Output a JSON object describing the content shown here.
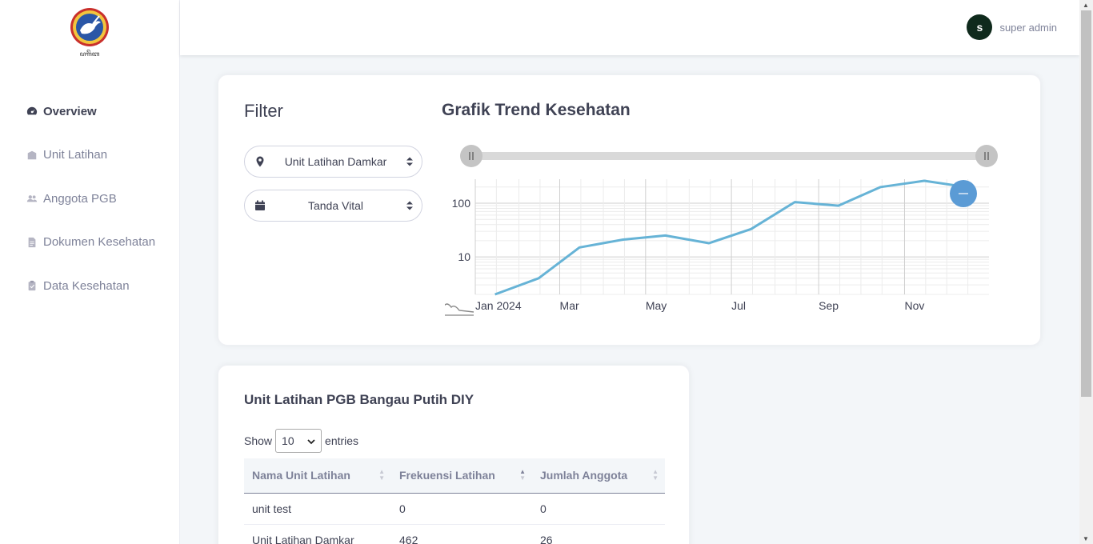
{
  "app": {
    "logo_text": "ꦥꦒꦼꦧꦱꦁꦒꦺꦪꦸꦛꦶꦃ",
    "colors": {
      "accent": "#5b9bd5",
      "line": "#66b3d6",
      "avatar": "#0f2a1c"
    }
  },
  "sidebar": {
    "items": [
      {
        "label": "Overview",
        "icon": "dashboard-icon",
        "active": true
      },
      {
        "label": "Unit Latihan",
        "icon": "building-icon",
        "active": false
      },
      {
        "label": "Anggota PGB",
        "icon": "users-icon",
        "active": false
      },
      {
        "label": "Dokumen Kesehatan",
        "icon": "file-icon",
        "active": false
      },
      {
        "label": "Data Kesehatan",
        "icon": "clipboard-icon",
        "active": false
      }
    ]
  },
  "topbar": {
    "avatar_letter": "s",
    "username": "super admin"
  },
  "filter": {
    "title": "Filter",
    "unit_select": {
      "value": "Unit Latihan Damkar",
      "icon": "map-marker-icon"
    },
    "category_select": {
      "value": "Tanda Vital",
      "icon": "calendar-icon"
    }
  },
  "chart_title": "Grafik Trend Kesehatan",
  "chart_data": {
    "type": "line",
    "title": "Grafik Trend Kesehatan",
    "y_scale": "log",
    "ylim": [
      2,
      280
    ],
    "y_ticks": [
      {
        "value": 10,
        "label": "10"
      },
      {
        "value": 100,
        "label": "100"
      }
    ],
    "x_ticks": [
      "Jan 2024",
      "Mar",
      "May",
      "Jul",
      "Sep",
      "Nov"
    ],
    "x": [
      "2024-01-15",
      "2024-02-15",
      "2024-03-15",
      "2024-04-15",
      "2024-05-15",
      "2024-06-15",
      "2024-07-15",
      "2024-08-15",
      "2024-09-15",
      "2024-10-15",
      "2024-11-15",
      "2024-12-15"
    ],
    "series": [
      {
        "values": [
          2,
          4,
          15,
          21,
          25,
          18,
          33,
          105,
          90,
          200,
          330,
          200
        ]
      }
    ]
  },
  "table_card": {
    "title": "Unit Latihan PGB Bangau Putih DIY",
    "show_label": "Show",
    "entries_value": "10",
    "entries_label": "entries",
    "columns": [
      "Nama Unit Latihan",
      "Frekuensi Latihan",
      "Jumlah Anggota"
    ],
    "rows": [
      [
        "unit test",
        "0",
        "0"
      ],
      [
        "Unit Latihan Damkar",
        "462",
        "26"
      ]
    ]
  }
}
